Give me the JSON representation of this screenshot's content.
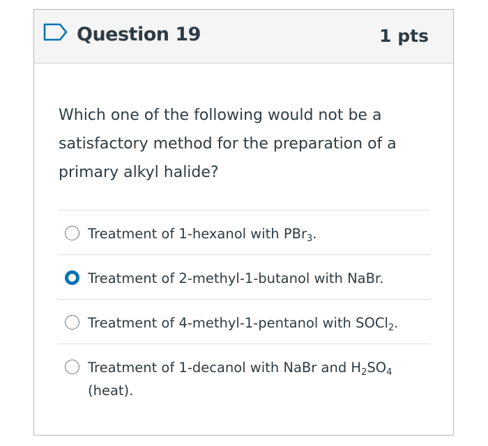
{
  "question": {
    "title": "Question 19",
    "points": "1 pts",
    "text": "Which one of the following would not be a satisfactory method for the preparation of a primary alkyl halide?"
  },
  "answers": [
    {
      "label": "Treatment of 1-hexanol with PBr",
      "sub": "3",
      "suffix": ".",
      "selected": false
    },
    {
      "label": "Treatment of 2-methyl-1-butanol with NaBr.",
      "selected": true
    },
    {
      "label": "Treatment of 4-methyl-1-pentanol with SOCl",
      "sub": "2",
      "suffix": ".",
      "selected": false
    },
    {
      "label": "Treatment of 1-decanol with NaBr and H",
      "sub": "2",
      "mid": "SO",
      "sub2": "4",
      "line2": "(heat).",
      "selected": false
    }
  ],
  "colors": {
    "accent": "#0374b5",
    "text": "#2d3b45",
    "header_bg": "#f5f5f5"
  },
  "icons": {
    "flag": "flag-outline-icon"
  }
}
